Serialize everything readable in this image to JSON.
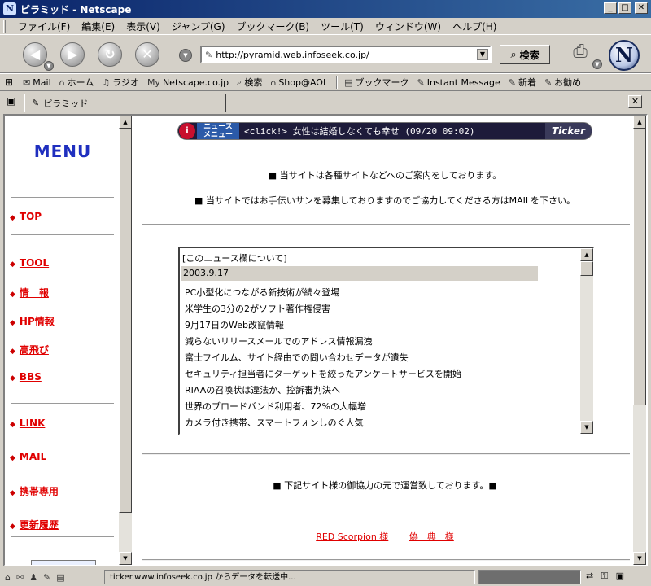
{
  "window": {
    "title": "ピラミッド - Netscape",
    "app_icon": "N"
  },
  "menubar": {
    "items": [
      "ファイル(F)",
      "編集(E)",
      "表示(V)",
      "ジャンプ(G)",
      "ブックマーク(B)",
      "ツール(T)",
      "ウィンドウ(W)",
      "ヘルプ(H)"
    ]
  },
  "navbar": {
    "url": "http://pyramid.web.infoseek.co.jp/",
    "search_label": "検索",
    "logo": "N"
  },
  "personal_toolbar": {
    "items": [
      {
        "icon": "mail-icon",
        "glyph": "✉",
        "label": "Mail"
      },
      {
        "icon": "home-icon",
        "glyph": "⌂",
        "label": "ホーム"
      },
      {
        "icon": "radio-icon",
        "glyph": "♫",
        "label": "ラジオ"
      },
      {
        "icon": "netscape-icon",
        "glyph": "My",
        "label": "Netscape.co.jp"
      },
      {
        "icon": "search-icon",
        "glyph": "⌕",
        "label": "検索"
      },
      {
        "icon": "shop-icon",
        "glyph": "⌂",
        "label": "Shop@AOL"
      },
      {
        "icon": "bookmark-icon",
        "glyph": "▤",
        "label": "ブックマーク"
      },
      {
        "icon": "link-icon",
        "glyph": "✎",
        "label": "Instant Message"
      },
      {
        "icon": "link-icon",
        "glyph": "✎",
        "label": "新着"
      },
      {
        "icon": "link-icon",
        "glyph": "✎",
        "label": "お勧め"
      }
    ]
  },
  "tab": {
    "label": "ピラミッド"
  },
  "sidebar": {
    "title": "MENU",
    "links": [
      "TOP",
      "TOOL",
      "情　報",
      "HP情報",
      "高飛び",
      "BBS",
      "LINK",
      "MAIL",
      "携帯専用",
      "更新履歴"
    ]
  },
  "ticker": {
    "logo": "i",
    "menu_label_1": "ニュース",
    "menu_label_2": "メニュー",
    "text": "<click!> 女性は結婚しなくても幸せ (09/20 09:02)",
    "brand": "Ticker"
  },
  "main": {
    "notice1": "■ 当サイトは各種サイトなどへのご案内をしております。",
    "notice2": "■ 当サイトではお手伝いサンを募集しておりますのでご協力してくださる方はMAILを下さい。",
    "news": {
      "header": "[このニュース欄について]",
      "date": "2003.9.17",
      "items": [
        "PC小型化につながる新技術が続々登場",
        "米学生の3分の2がソフト著作権侵害",
        "9月17日のWeb改竄情報",
        "減らないリリースメールでのアドレス情報漏洩",
        "富士フイルム、サイト経由での問い合わせデータが遺失",
        "セキュリティ担当者にターゲットを絞ったアンケートサービスを開始",
        "RIAAの召喚状は違法か、控訴審判決へ",
        "世界のブロードバンド利用者、72%の大幅増",
        "カメラ付き携帯、スマートフォンしのぐ人気"
      ]
    },
    "partner_note": "■ 下記サイト様の御協力の元で運営致しております。■",
    "partners": [
      "RED Scorpion 様",
      "偽　典　様"
    ]
  },
  "statusbar": {
    "text": "ticker.www.infoseek.co.jp からデータを転送中...",
    "progress": 1.0
  }
}
